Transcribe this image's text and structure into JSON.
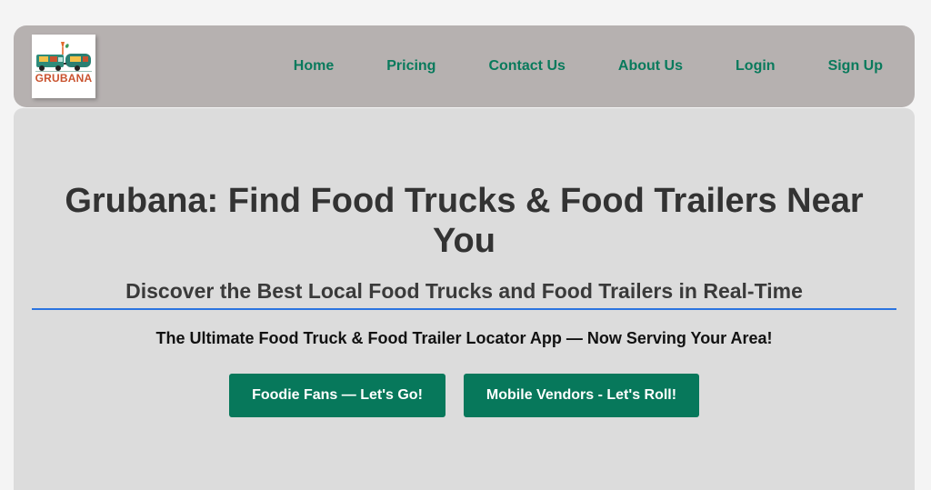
{
  "header": {
    "logo": {
      "text": "GRUBANA",
      "icon": "food-truck-logo-icon"
    },
    "nav": [
      {
        "label": "Home"
      },
      {
        "label": "Pricing"
      },
      {
        "label": "Contact Us"
      },
      {
        "label": "About Us"
      },
      {
        "label": "Login"
      },
      {
        "label": "Sign Up"
      }
    ]
  },
  "hero": {
    "title": "Grubana: Find Food Trucks & Food Trailers Near You",
    "subtitle": "Discover the Best Local Food Trucks and Food Trailers in Real-Time",
    "tagline": "The Ultimate Food Truck & Food Trailer Locator App — Now Serving Your Area!",
    "buttons": [
      {
        "label": "Foodie Fans — Let's Go!"
      },
      {
        "label": "Mobile Vendors - Let's Roll!"
      }
    ]
  },
  "colors": {
    "navbar_bg": "#b6b1b0",
    "nav_link": "#097a5c",
    "hero_bg": "#dcdcdc",
    "divider": "#2b74e0",
    "button_bg": "#07785b",
    "logo_text": "#c9532f"
  }
}
